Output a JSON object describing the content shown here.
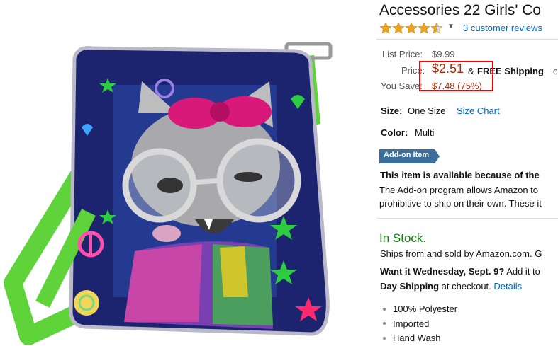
{
  "product": {
    "title": "Accessories 22 Girls' Co",
    "rating_stars": 4.5,
    "reviews_link": "3 customer reviews"
  },
  "pricing": {
    "list_price_label": "List Price:",
    "list_price": "$9.99",
    "price_label": "Price:",
    "price": "$2.51",
    "amp": "&",
    "free_shipping": "FREE Shipping",
    "free_shipping_tail": "c",
    "you_save_label": "You Save:",
    "you_save": "$7.48 (75%)"
  },
  "options": {
    "size_label": "Size:",
    "size_value": "One Size",
    "size_chart": "Size Chart",
    "color_label": "Color:",
    "color_value": "Multi"
  },
  "addon": {
    "badge": "Add-on Item",
    "bold_line": "This item is available because of the",
    "line1": "The Add-on program allows Amazon to",
    "line2": "prohibitive to ship on their own. These it"
  },
  "availability": {
    "status": "In Stock.",
    "ships_from": "Ships from and sold by Amazon.com. G",
    "want_bold": "Want it Wednesday, Sept. 9?",
    "want_rest": " Add it to",
    "day_shipping_bold": "Day Shipping",
    "at_checkout": " at checkout. ",
    "details_link": "Details"
  },
  "features": [
    "100% Polyester",
    "Imported",
    "Hand Wash"
  ],
  "colors": {
    "link": "#0066c0",
    "price": "#b12704",
    "in_stock": "#008a00",
    "highlight_box": "#e00000",
    "addon_badge": "#3b6e98"
  }
}
